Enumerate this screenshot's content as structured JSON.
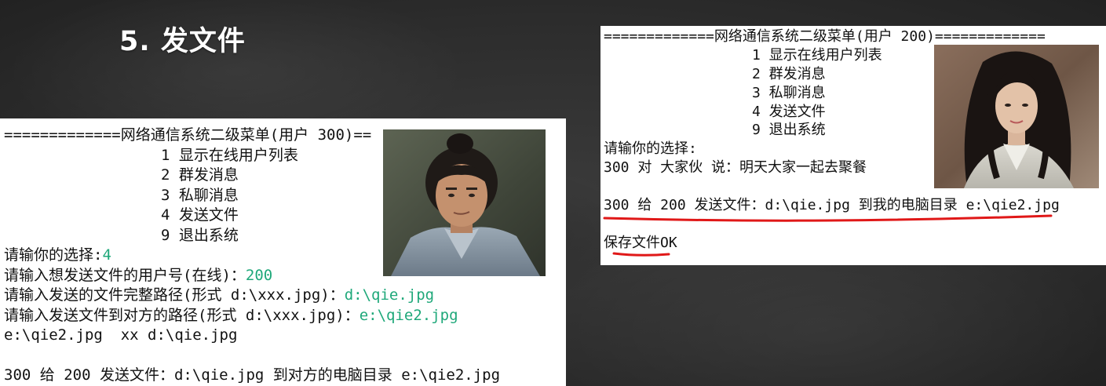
{
  "slide": {
    "title": "5. 发文件"
  },
  "left_console": {
    "header": "=============网络通信系统二级菜单(用户 300)==",
    "menu_items": [
      "1 显示在线用户列表",
      "2 群发消息",
      "3 私聊消息",
      "4 发送文件",
      "9 退出系统"
    ],
    "choice_prompt": "请输你的选择:",
    "choice_input": "4",
    "prompts": [
      {
        "text": "请输入想发送文件的用户号(在线)：",
        "input": "200"
      },
      {
        "text": "请输入发送的文件完整路径(形式 d:\\xxx.jpg)：",
        "input": "d:\\qie.jpg"
      },
      {
        "text": "请输入发送文件到对方的路径(形式 d:\\xxx.jpg)：",
        "input": "e:\\qie2.jpg"
      }
    ],
    "echo_line": "e:\\qie2.jpg  xx d:\\qie.jpg",
    "result_line": "300 给 200 发送文件：d:\\qie.jpg 到对方的电脑目录 e:\\qie2.jpg"
  },
  "right_console": {
    "header": "=============网络通信系统二级菜单(用户 200)=============",
    "menu_items": [
      "1 显示在线用户列表",
      "2 群发消息",
      "3 私聊消息",
      "4 发送文件",
      "9 退出系统"
    ],
    "choice_prompt": "请输你的选择:",
    "chat_line": "300 对 大家伙 说：明天大家一起去聚餐",
    "file_line": "300 给 200 发送文件：d:\\qie.jpg 到我的电脑目录 e:\\qie2.jpg",
    "saved_line": "保存文件OK"
  },
  "colors": {
    "background": "#2d2d2d",
    "panel": "#ffffff",
    "console_text": "#111111",
    "input_text": "#1fa87a",
    "underline": "#e01818",
    "title": "#ffffff"
  }
}
